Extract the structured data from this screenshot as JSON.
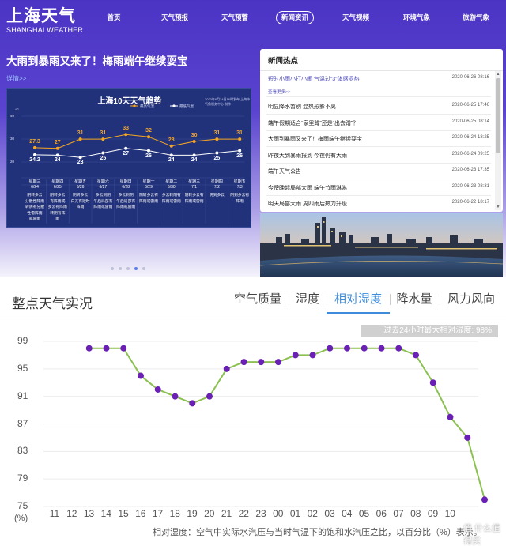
{
  "site": {
    "logo_cn": "上海天气",
    "logo_en": "SHANGHAI WEATHER",
    "nav": [
      "首页",
      "天气预报",
      "天气预警",
      "新闻资讯",
      "天气视频",
      "环境气象",
      "旅游气象"
    ],
    "nav_active_index": 3
  },
  "headline": {
    "title": "大雨到暴雨又来了！梅雨端午继续耍宝",
    "detail_link": "详情>>"
  },
  "forecast_card": {
    "title": "上海10天天气趋势",
    "published": "2020年6月24日16时发布 上海市气象服务中心 制作",
    "legend_high": "最高气温",
    "legend_low": "最低气温",
    "unit": "℃",
    "axis_labels": [
      "40",
      "30",
      "20"
    ],
    "days": [
      {
        "week": "星期三",
        "date": "6/24",
        "cond": [
          "阴转多云",
          "分散性阵雨",
          "转阴有分散",
          "性雷阵雨",
          "或雷雨"
        ]
      },
      {
        "week": "星期四",
        "date": "6/25",
        "cond": [
          "阴转多云",
          "有阵雨或",
          "多云有阵雨",
          "转阴有阵",
          "雨"
        ]
      },
      {
        "week": "星期五",
        "date": "6/26",
        "cond": [
          "阴转多云",
          "白天有短时",
          "阵雨"
        ]
      },
      {
        "week": "星期六",
        "date": "6/27",
        "cond": [
          "多云到阴",
          "午后局部有",
          "阵雨或雷雨"
        ]
      },
      {
        "week": "星期日",
        "date": "6/28",
        "cond": [
          "多云到阴",
          "午后局部有",
          "阵雨或雷雨"
        ]
      },
      {
        "week": "星期一",
        "date": "6/29",
        "cond": [
          "阴转多云有",
          "阵雨或雷雨"
        ]
      },
      {
        "week": "星期二",
        "date": "6/30",
        "cond": [
          "多云转阴有",
          "阵雨或雷雨"
        ]
      },
      {
        "week": "星期三",
        "date": "7/1",
        "cond": [
          "阴转多云有",
          "阵雨或雷雨"
        ]
      },
      {
        "week": "星期四",
        "date": "7/2",
        "cond": [
          "阴到多云"
        ]
      },
      {
        "week": "星期五",
        "date": "7/3",
        "cond": [
          "阴到多云有",
          "阵雨"
        ]
      }
    ],
    "highs": [
      "27.3",
      "27",
      "31",
      "31",
      "33",
      "32",
      "28",
      "30",
      "31",
      "31"
    ],
    "lows": [
      "24.2",
      "24",
      "23",
      "25",
      "27",
      "26",
      "24",
      "24",
      "25",
      "26"
    ],
    "high_values": [
      27.3,
      27,
      31,
      31,
      33,
      32,
      28,
      30,
      31,
      31
    ],
    "low_values": [
      24.2,
      24,
      23,
      25,
      27,
      26,
      24,
      24,
      25,
      26
    ],
    "colors": {
      "high": "#f5a623",
      "low": "#ffffff"
    }
  },
  "carousel": {
    "count": 5,
    "active_index": 3
  },
  "news": {
    "title": "新闻热点",
    "more": "查看更多>>",
    "items": [
      {
        "title": "短时小雨小打小闹 气温过“3”体感闷热",
        "date": "2020-06-26 08:16"
      },
      {
        "title": "明显降水暂别 混热形影不离",
        "date": "2020-06-25 17:46"
      },
      {
        "title": "端午假期适合“家里蹲”还是“出去蹭”？",
        "date": "2020-06-25 08:14"
      },
      {
        "title": "大雨到暴雨又来了！梅雨端午继续耍宝",
        "date": "2020-06-24 18:25"
      },
      {
        "title": "昨夜大到暴雨报到 今夜仍有大雨",
        "date": "2020-06-24 09:25"
      },
      {
        "title": "端午天气公告",
        "date": "2020-06-23 17:35"
      },
      {
        "title": "今傍晚起局部大雨 端午节雨淋淋",
        "date": "2020-06-23 08:31"
      },
      {
        "title": "明天局部大雨 周四雨后热力升级",
        "date": "2020-06-22 18:17"
      }
    ]
  },
  "observation": {
    "title": "整点天气实况",
    "tabs": [
      "空气质量",
      "湿度",
      "相对湿度",
      "降水量",
      "风力风向"
    ],
    "active_tab_index": 2,
    "max_badge": "过去24小时最大相对湿度: 98%",
    "unit": "(%)",
    "note": "相对湿度：空气中实际水汽压与当时气温下的饱和水汽压之比，以百分比（%）表示。",
    "watermark": "值 什么值得买"
  },
  "chart_data": {
    "type": "line",
    "title": "",
    "xlabel": "",
    "ylabel": "(%)",
    "categories": [
      "11",
      "12",
      "13",
      "14",
      "15",
      "16",
      "17",
      "18",
      "19",
      "20",
      "21",
      "22",
      "23",
      "00",
      "01",
      "02",
      "03",
      "04",
      "05",
      "06",
      "07",
      "08",
      "09",
      "10"
    ],
    "y_ticks": [
      99,
      95,
      91,
      87,
      83,
      79,
      75
    ],
    "ylim": [
      75,
      99
    ],
    "grid": true,
    "series": [
      {
        "values": [
          null,
          98,
          98,
          98,
          94,
          92,
          91,
          90,
          91,
          95,
          96,
          96,
          96,
          97,
          97,
          98,
          98,
          98,
          98,
          98,
          97,
          93,
          88,
          85,
          76
        ]
      }
    ],
    "colors": {
      "line": "#8cc152",
      "point": "#6a1fb5"
    }
  }
}
